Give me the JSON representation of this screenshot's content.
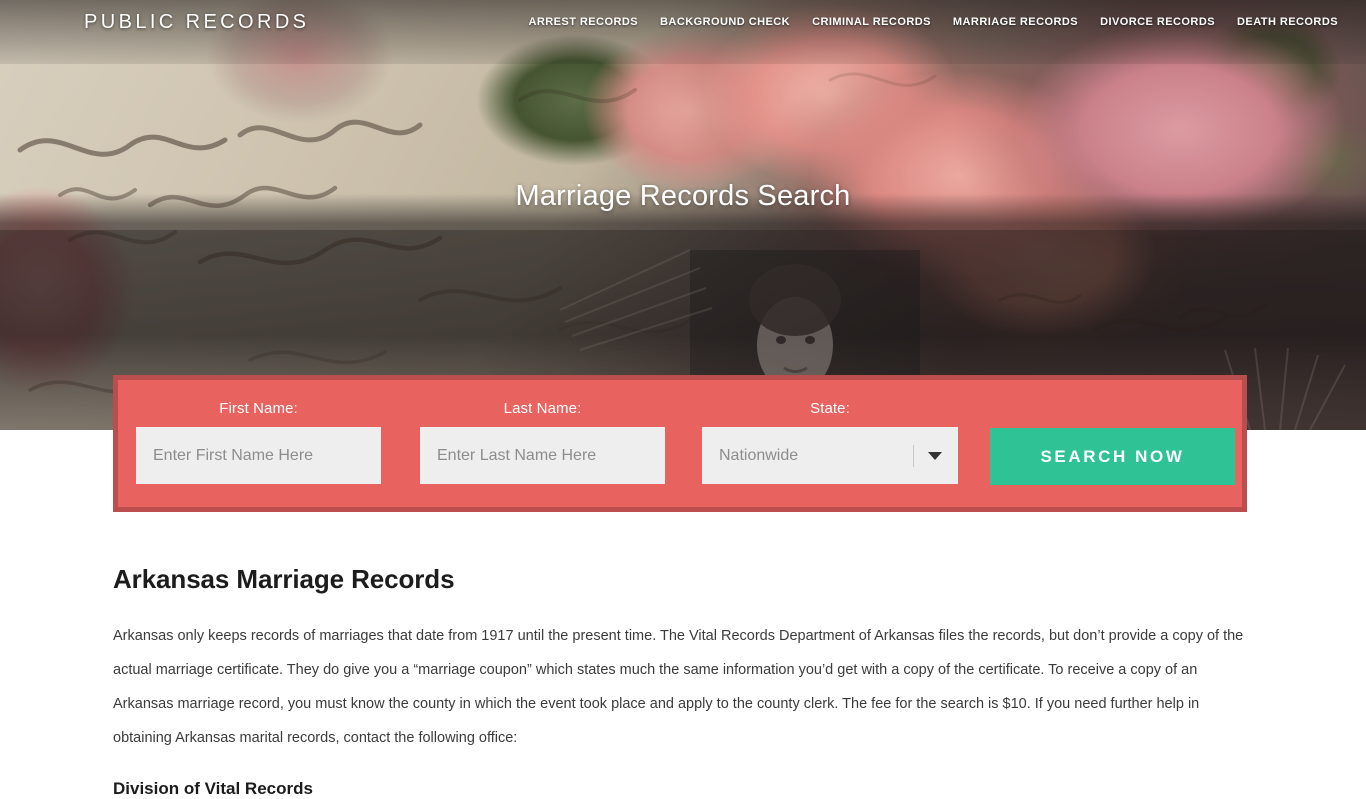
{
  "header": {
    "logo": "PUBLIC RECORDS",
    "nav": [
      {
        "label": "ARREST RECORDS"
      },
      {
        "label": "BACKGROUND CHECK"
      },
      {
        "label": "CRIMINAL RECORDS"
      },
      {
        "label": "MARRIAGE RECORDS"
      },
      {
        "label": "DIVORCE RECORDS"
      },
      {
        "label": "DEATH RECORDS"
      }
    ]
  },
  "hero": {
    "title": "Marriage Records Search",
    "background_description": "vintage German marriage certificate with pink roses and antique portrait photograph"
  },
  "search_form": {
    "first_name": {
      "label": "First Name:",
      "placeholder": "Enter First Name Here",
      "value": ""
    },
    "last_name": {
      "label": "Last Name:",
      "placeholder": "Enter Last Name Here",
      "value": ""
    },
    "state": {
      "label": "State:",
      "selected": "Nationwide"
    },
    "submit_label": "SEARCH NOW",
    "colors": {
      "panel": "#e8625f",
      "panel_border": "#b94e4c",
      "button": "#2ec295",
      "input": "#eeeeee"
    }
  },
  "article": {
    "heading": "Arkansas Marriage Records",
    "paragraph": "Arkansas only keeps records of marriages that date from 1917 until the present time. The Vital Records Department of Arkansas files the records, but don’t provide a copy of the actual marriage certificate. They do give you a “marriage coupon” which states much the same information you’d get with a copy of the certificate. To receive a copy of an Arkansas marriage record, you must know the county in which the event took place and apply to the county clerk. The fee for the search is $10. If you need further help in obtaining Arkansas marital records, contact the following office:",
    "subheading": "Division of Vital Records"
  }
}
